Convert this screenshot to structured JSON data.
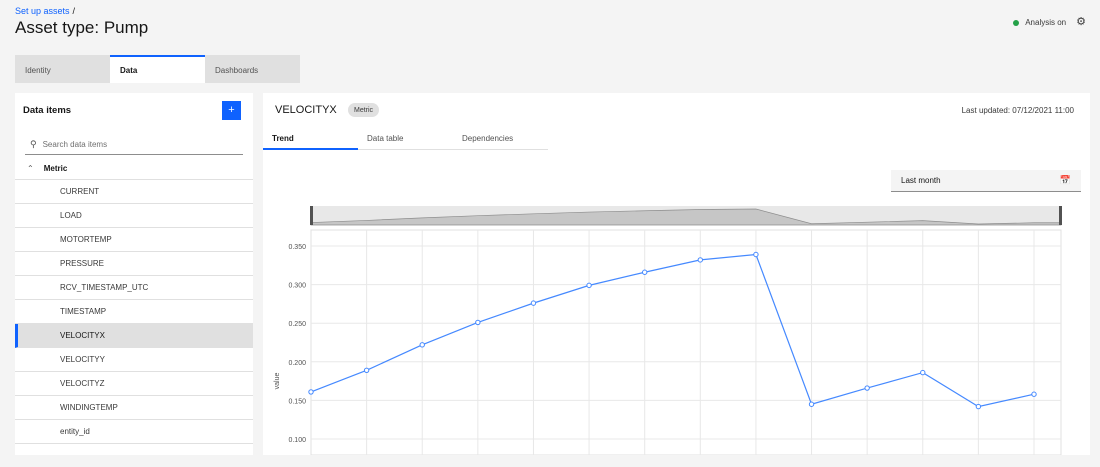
{
  "breadcrumb": {
    "link": "Set up assets",
    "separator": "/"
  },
  "page_title": "Asset type: Pump",
  "status": {
    "label": "Analysis on",
    "color": "#24a148"
  },
  "tabs": [
    {
      "label": "Identity"
    },
    {
      "label": "Data"
    },
    {
      "label": "Dashboards"
    }
  ],
  "data_items": {
    "title": "Data items",
    "add_icon": "+",
    "search_placeholder": "Search data items",
    "group_label": "Metric",
    "items": [
      {
        "label": "CURRENT"
      },
      {
        "label": "LOAD"
      },
      {
        "label": "MOTORTEMP"
      },
      {
        "label": "PRESSURE"
      },
      {
        "label": "RCV_TIMESTAMP_UTC"
      },
      {
        "label": "TIMESTAMP"
      },
      {
        "label": "VELOCITYX"
      },
      {
        "label": "VELOCITYY"
      },
      {
        "label": "VELOCITYZ"
      },
      {
        "label": "WINDINGTEMP"
      },
      {
        "label": "entity_id"
      }
    ]
  },
  "detail": {
    "name": "VELOCITYX",
    "badge": "Metric",
    "last_updated": "Last updated: 07/12/2021 11:00",
    "subtabs": [
      {
        "label": "Trend"
      },
      {
        "label": "Data table"
      },
      {
        "label": "Dependencies"
      }
    ],
    "date_range": "Last month"
  },
  "chart_data": {
    "type": "line",
    "ylabel": "value",
    "y_ticks": [
      "0.350",
      "0.300",
      "0.250",
      "0.200",
      "0.150",
      "0.100"
    ],
    "ylim": [
      0.1,
      0.35
    ],
    "values": [
      0.161,
      0.189,
      0.222,
      0.251,
      0.276,
      0.299,
      0.316,
      0.332,
      0.339,
      0.145,
      0.166,
      0.186,
      0.142,
      0.158
    ],
    "series_color": "#4589ff",
    "grid": true,
    "overview_values": [
      0.161,
      0.189,
      0.222,
      0.251,
      0.276,
      0.299,
      0.316,
      0.332,
      0.339,
      0.145,
      0.166,
      0.186,
      0.142,
      0.158
    ]
  }
}
